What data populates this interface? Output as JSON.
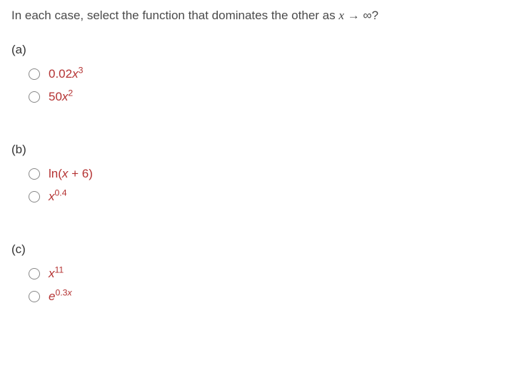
{
  "prompt": {
    "text_before": "In each case, select the function that dominates the other as ",
    "math_var": "x",
    "arrow": " → ∞",
    "text_after": "?"
  },
  "groups": [
    {
      "label": "(a)",
      "options": [
        {
          "coef": "0.02",
          "base": "x",
          "sup": "3"
        },
        {
          "coef": "50",
          "base": "x",
          "sup": "2"
        }
      ]
    },
    {
      "label": "(b)",
      "options": [
        {
          "fn": "ln(",
          "base": "x",
          "after": " + 6)"
        },
        {
          "base": "x",
          "sup": "0.4"
        }
      ]
    },
    {
      "label": "(c)",
      "options": [
        {
          "base": "x",
          "sup": "11"
        },
        {
          "base": "e",
          "sup_prefix": "0.3",
          "sup_var": "x"
        }
      ]
    }
  ]
}
